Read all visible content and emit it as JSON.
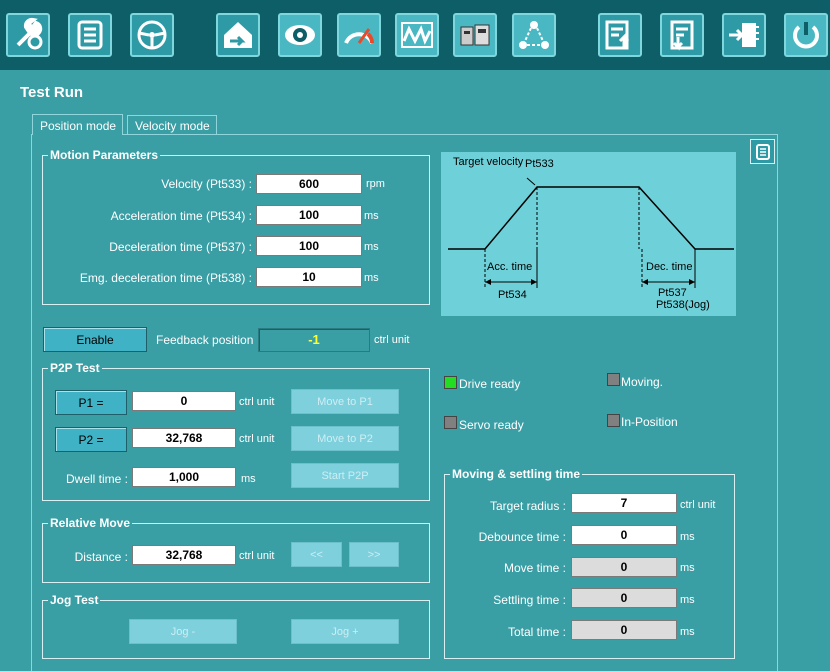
{
  "toolbar": {
    "buttons": [
      {
        "name": "tools",
        "icon": "wrench-gear-icon"
      },
      {
        "name": "document",
        "icon": "document-list-icon"
      },
      {
        "name": "steering",
        "icon": "steering-wheel-icon"
      },
      {
        "name": "home",
        "icon": "home-back-icon"
      },
      {
        "name": "monitor",
        "icon": "eye-icon"
      },
      {
        "name": "gauge",
        "icon": "speedometer-icon"
      },
      {
        "name": "scope",
        "icon": "scope-waveform-icon"
      },
      {
        "name": "drives",
        "icon": "drive-units-icon"
      },
      {
        "name": "network",
        "icon": "network-nodes-icon"
      },
      {
        "name": "upload",
        "icon": "upload-params-icon"
      },
      {
        "name": "download",
        "icon": "download-params-icon"
      },
      {
        "name": "firmware",
        "icon": "firmware-chip-icon"
      },
      {
        "name": "reset",
        "icon": "power-reset-icon"
      }
    ]
  },
  "page": {
    "title": "Test Run"
  },
  "tabs": [
    {
      "label": "Position mode",
      "active": true
    },
    {
      "label": "Velocity mode",
      "active": false
    }
  ],
  "motion": {
    "group_label": "Motion Parameters",
    "rows": [
      {
        "label": "Velocity (Pt533) :",
        "value": "600",
        "unit": "rpm"
      },
      {
        "label": "Acceleration time (Pt534) :",
        "value": "100",
        "unit": "ms"
      },
      {
        "label": "Deceleration time (Pt537) :",
        "value": "100",
        "unit": "ms"
      },
      {
        "label": "Emg. deceleration time (Pt538) :",
        "value": "10",
        "unit": "ms"
      }
    ]
  },
  "diagram": {
    "target_velocity": "Target velocity",
    "pt533": "Pt533",
    "acc_time": "Acc. time",
    "pt534": "Pt534",
    "dec_time": "Dec. time",
    "pt537": "Pt537",
    "pt538": "Pt538(Jog)"
  },
  "enable": {
    "button": "Enable",
    "feedback_label": "Feedback position",
    "feedback_value": "-1",
    "feedback_unit": "ctrl unit"
  },
  "p2p": {
    "group_label": "P2P Test",
    "p1_button": "P1 =",
    "p1_value": "0",
    "p1_unit": "ctrl unit",
    "move_p1": "Move to P1",
    "p2_button": "P2 =",
    "p2_value": "32,768",
    "p2_unit": "ctrl unit",
    "move_p2": "Move to P2",
    "dwell_label": "Dwell time :",
    "dwell_value": "1,000",
    "dwell_unit": "ms",
    "start": "Start P2P"
  },
  "relative": {
    "group_label": "Relative Move",
    "distance_label": "Distance :",
    "distance_value": "32,768",
    "distance_unit": "ctrl unit",
    "back": "<<",
    "fwd": ">>"
  },
  "jog": {
    "group_label": "Jog Test",
    "minus": "Jog -",
    "plus": "Jog +"
  },
  "status": {
    "drive_ready": {
      "label": "Drive ready",
      "color": "#22dd22"
    },
    "servo_ready": {
      "label": "Servo ready",
      "color": "#808080"
    },
    "moving": {
      "label": "Moving.",
      "color": "#808080"
    },
    "in_position": {
      "label": "In-Position",
      "color": "#808080"
    }
  },
  "settling": {
    "group_label": "Moving & settling time",
    "rows": [
      {
        "label": "Target radius :",
        "value": "7",
        "unit": "ctrl unit",
        "readonly": false
      },
      {
        "label": "Debounce time :",
        "value": "0",
        "unit": "ms",
        "readonly": false
      },
      {
        "label": "Move time :",
        "value": "0",
        "unit": "ms",
        "readonly": true
      },
      {
        "label": "Settling time :",
        "value": "0",
        "unit": "ms",
        "readonly": true
      },
      {
        "label": "Total time :",
        "value": "0",
        "unit": "ms",
        "readonly": true
      }
    ]
  },
  "colors": {
    "background": "#3a9ea5",
    "toolbar": "#0d5e66",
    "diagram": "#6ed0d8",
    "feedback_text": "#ffff33"
  }
}
